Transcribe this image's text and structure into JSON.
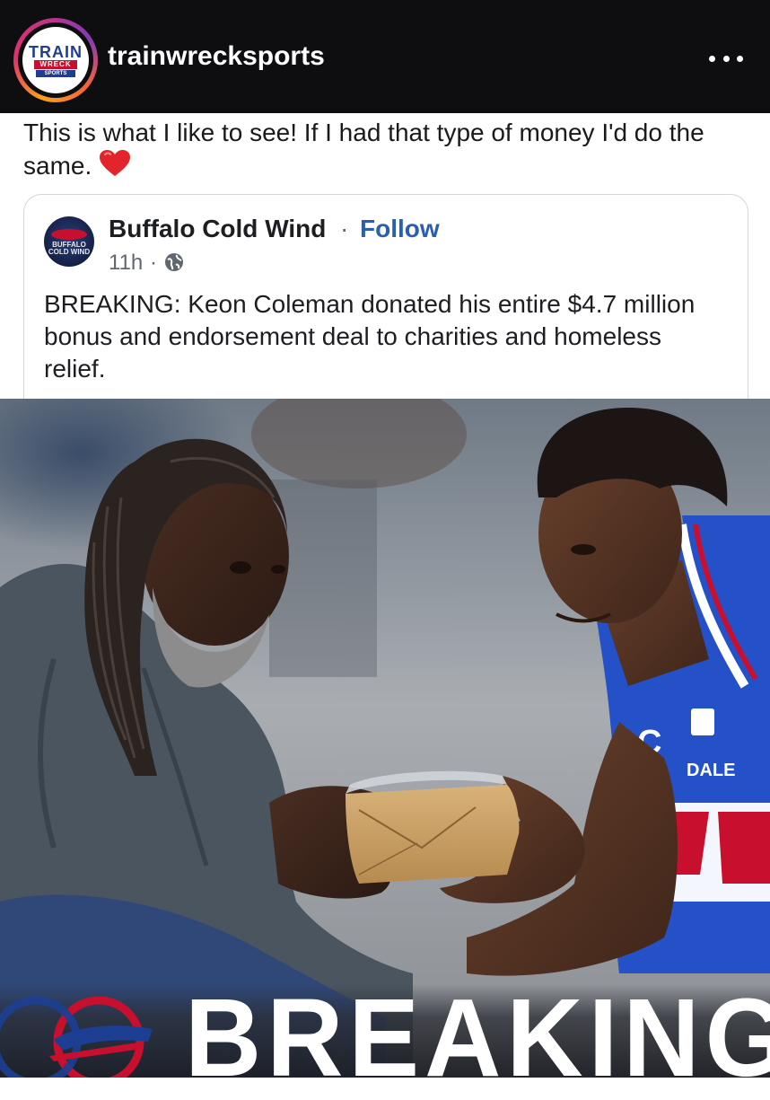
{
  "header": {
    "avatar_logo": {
      "line1": "TRAIN",
      "line2": "WRECK",
      "line3": "SPORTS"
    },
    "username": "trainwrecksports",
    "more_icon": "more-horizontal-icon"
  },
  "caption": {
    "text": "This is what I like to see! If I had that type of money I'd do the same.",
    "emoji": "heart-icon"
  },
  "embedded_post": {
    "page_avatar_text": "BUFFALO COLD WIND",
    "page_name": "Buffalo Cold Wind",
    "separator": "·",
    "follow_label": "Follow",
    "time": "11h",
    "time_separator": "·",
    "privacy_icon": "globe-icon",
    "text": "BREAKING: Keon Coleman donated his entire $4.7 million bonus and endorsement deal to charities and homeless relief."
  },
  "photo": {
    "jersey_text": "DALE",
    "jersey_letter": "C",
    "banner_text": "BREAKING",
    "colors": {
      "jersey": "#2450c8",
      "banner_bg": "#2a2c33",
      "bills_red": "#c8102e",
      "bills_blue": "#1c3f94"
    }
  }
}
